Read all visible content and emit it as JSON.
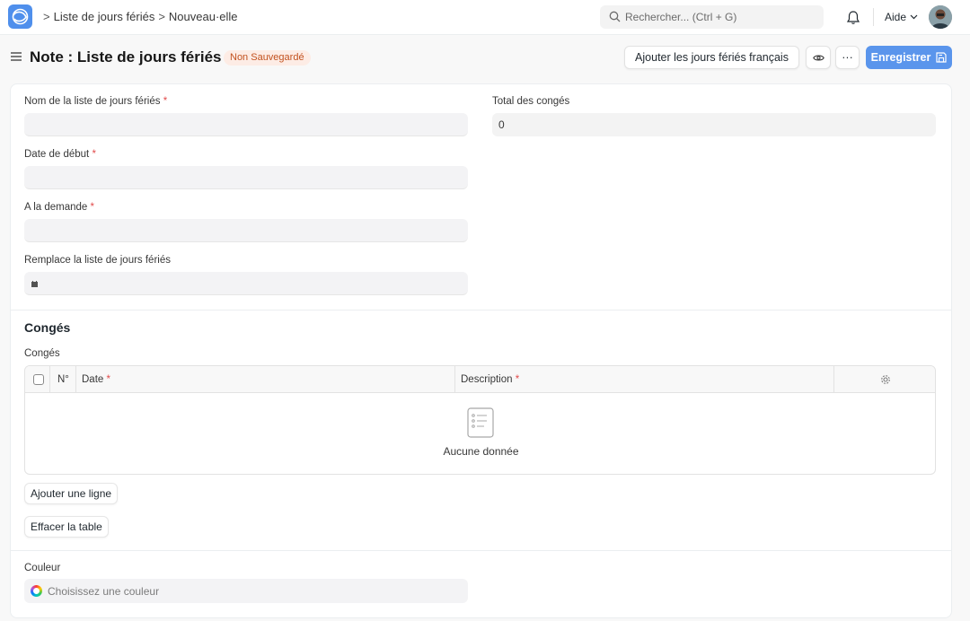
{
  "navbar": {
    "breadcrumbs": [
      "Liste de jours fériés",
      "Nouveau·elle"
    ],
    "breadcrumb_separator": ">",
    "search_placeholder": "Rechercher... (Ctrl + G)",
    "help_label": "Aide",
    "icons": [
      "app-logo",
      "search-icon",
      "bell-icon",
      "chevron-down-icon",
      "avatar"
    ]
  },
  "page_head": {
    "title": "Note : Liste de jours fériés",
    "status_badge": "Non Sauvegardé",
    "buttons": {
      "add_french_holidays": "Ajouter les jours fériés français",
      "more": "···",
      "save": "Enregistrer"
    }
  },
  "form": {
    "holiday_list_name": {
      "label": "Nom de la liste de jours fériés",
      "required_marker": "*",
      "value": ""
    },
    "from_date": {
      "label": "Date de début",
      "required_marker": "*",
      "value": ""
    },
    "to_date": {
      "label": "A la demande",
      "required_marker": "*",
      "value": ""
    },
    "replaces_holiday_list": {
      "label": "Remplace la liste de jours fériés",
      "value": ""
    },
    "total_holidays": {
      "label": "Total des congés",
      "value": "0"
    }
  },
  "holidays_section": {
    "title": "Congés",
    "table_label": "Congés",
    "columns": [
      {
        "label": "N°",
        "required": false
      },
      {
        "label": "Date",
        "required": true
      },
      {
        "label": "Description",
        "required": true
      }
    ],
    "required_marker": "*",
    "rows": [],
    "empty_text": "Aucune donnée",
    "add_row_label": "Ajouter une ligne",
    "clear_table_label": "Effacer la table"
  },
  "color_section": {
    "label": "Couleur",
    "placeholder": "Choisissez une couleur"
  },
  "colors": {
    "primary": "#5a95ec",
    "badge_bg": "#fdece5",
    "badge_text": "#c2521f",
    "required": "#e24c4c"
  }
}
